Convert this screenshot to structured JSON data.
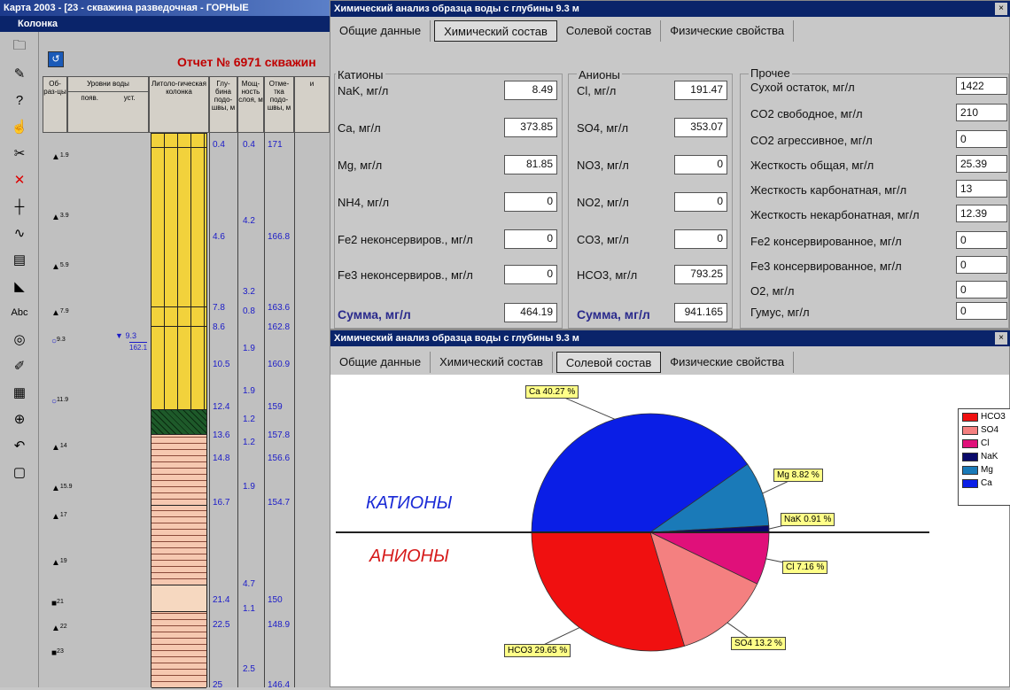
{
  "bg_window": {
    "title": "Карта 2003 - [23 - скважина разведочная - ГОРНЫЕ",
    "subtitle": "Колонка",
    "report_title": "Отчет № 6971 скважин",
    "columns": {
      "samples": "Об-раз-цы",
      "water": "Уровни воды",
      "water_app": "появ.",
      "water_est": "уст.",
      "litho": "Литоло-гическая колонка",
      "depth": "Глу-бина подо-швы, м",
      "thick": "Мощ-ность слоя, м",
      "mark": "Отме-тка подо-швы, м",
      "extra": "и"
    },
    "depths": [
      "0.4",
      "4.6",
      "7.8",
      "8.6",
      "10.5",
      "12.4",
      "13.6",
      "14.8",
      "16.7",
      "21.4",
      "22.5",
      "25"
    ],
    "thicknesses": [
      "0.4",
      "4.2",
      "3.2",
      "0.8",
      "1.9",
      "1.9",
      "1.2",
      "1.2",
      "1.9",
      "4.7",
      "1.1",
      "2.5"
    ],
    "marks": [
      "171",
      "166.8",
      "163.6",
      "162.8",
      "160.9",
      "159",
      "157.8",
      "156.6",
      "154.7",
      "150",
      "148.9",
      "146.4"
    ],
    "samples": [
      "1.9",
      "3.9",
      "5.9",
      "7.9",
      "9.3",
      "11.9",
      "14",
      "15.9",
      "17",
      "19",
      "21",
      "22",
      "23"
    ],
    "water_level": "9.3",
    "water_mark": "162.1",
    "tool_icons": [
      "folder-icon",
      "pencil-icon",
      "question-pencil-icon",
      "pointer-icon",
      "scissors-icon",
      "delete-x-icon",
      "plus-icon",
      "curve-icon",
      "layer-icon",
      "fill-icon",
      "text-abc-icon",
      "compass-icon",
      "brush-icon",
      "grid-icon",
      "zoom-icon",
      "undo-icon",
      "window-icon"
    ]
  },
  "chem_window": {
    "title": "Химический анализ образца воды с глубины  9.3 м",
    "tabs": [
      "Общие данные",
      "Химический состав",
      "Солевой состав",
      "Физические свойства"
    ],
    "active_tab": "Химический состав",
    "cations": {
      "label": "Катионы",
      "rows": [
        {
          "label": "NaK, мг/л",
          "value": "8.49"
        },
        {
          "label": "Ca, мг/л",
          "value": "373.85"
        },
        {
          "label": "Mg, мг/л",
          "value": "81.85"
        },
        {
          "label": "NH4, мг/л",
          "value": "0"
        },
        {
          "label": "Fe2 неконсервиров., мг/л",
          "value": "0"
        },
        {
          "label": "Fe3 неконсервиров., мг/л",
          "value": "0"
        }
      ],
      "sum_label": "Сумма, мг/л",
      "sum_value": "464.19"
    },
    "anions": {
      "label": "Анионы",
      "rows": [
        {
          "label": "Cl, мг/л",
          "value": "191.47"
        },
        {
          "label": "SO4, мг/л",
          "value": "353.07"
        },
        {
          "label": "NO3, мг/л",
          "value": "0"
        },
        {
          "label": "NO2, мг/л",
          "value": "0"
        },
        {
          "label": "CO3, мг/л",
          "value": "0"
        },
        {
          "label": "HCO3, мг/л",
          "value": "793.25"
        }
      ],
      "sum_label": "Сумма, мг/л",
      "sum_value": "941.165"
    },
    "other": {
      "label": "Прочее",
      "rows": [
        {
          "label": "Сухой остаток, мг/л",
          "value": "1422"
        },
        {
          "label": "CO2 свободное, мг/л",
          "value": "210"
        },
        {
          "label": "CO2 агрессивное, мг/л",
          "value": "0"
        },
        {
          "label": "Жесткость общая, мг/л",
          "value": "25.39"
        },
        {
          "label": "Жесткость карбонатная, мг/л",
          "value": "13"
        },
        {
          "label": "Жесткость некарбонатная, мг/л",
          "value": "12.39"
        },
        {
          "label": "Fe2 консервированное, мг/л",
          "value": "0"
        },
        {
          "label": "Fe3 консервированное, мг/л",
          "value": "0"
        },
        {
          "label": "O2, мг/л",
          "value": "0"
        },
        {
          "label": "Гумус, мг/л",
          "value": "0"
        }
      ]
    }
  },
  "salt_window": {
    "title": "Химический анализ образца воды с глубины  9.3 м",
    "tabs": [
      "Общие данные",
      "Химический состав",
      "Солевой состав",
      "Физические свойства"
    ],
    "active_tab": "Солевой состав",
    "cation_caption": "КАТИОНЫ",
    "anion_caption": "АНИОНЫ"
  },
  "chart_data": {
    "type": "pie",
    "series": [
      {
        "group": "cations",
        "slices": [
          {
            "label": "Ca",
            "value": 40.27,
            "text": "Ca 40.27 %",
            "color": "#0a1ee6"
          },
          {
            "label": "Mg",
            "value": 8.82,
            "text": "Mg 8.82 %",
            "color": "#1a7ab8"
          },
          {
            "label": "NaK",
            "value": 0.91,
            "text": "NaK 0.91 %",
            "color": "#0a0a6a"
          }
        ]
      },
      {
        "group": "anions",
        "slices": [
          {
            "label": "Cl",
            "value": 7.16,
            "text": "Cl 7.16 %",
            "color": "#e0107a"
          },
          {
            "label": "SO4",
            "value": 13.2,
            "text": "SO4 13.2 %",
            "color": "#f48080"
          },
          {
            "label": "HCO3",
            "value": 29.65,
            "text": "HCO3 29.65 %",
            "color": "#f01010"
          }
        ]
      }
    ],
    "legend": [
      "HCO3",
      "SO4",
      "Cl",
      "NaK",
      "Mg",
      "Ca"
    ],
    "legend_position": "right"
  }
}
